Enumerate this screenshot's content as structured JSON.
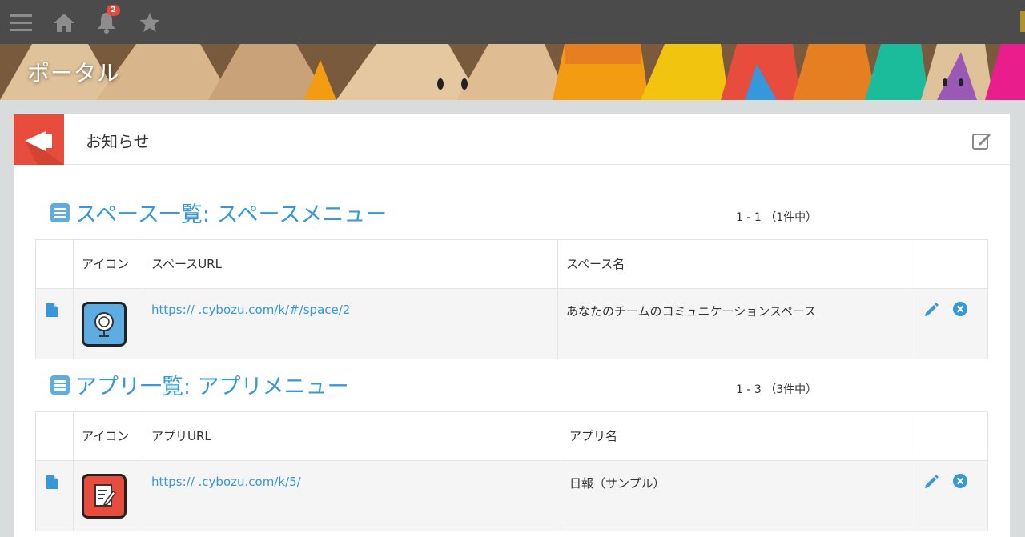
{
  "topbar": {
    "icons": [
      "menu-icon",
      "home-icon",
      "bell-icon",
      "star-icon"
    ],
    "notification_count": "2"
  },
  "banner": {
    "title": "ポータル"
  },
  "notice": {
    "title": "お知らせ"
  },
  "space_section": {
    "title": "スペース一覧: スペースメニュー",
    "count": "1 - 1 （1件中）",
    "columns": [
      "",
      "アイコン",
      "スペースURL",
      "スペース名",
      ""
    ],
    "rows": [
      {
        "url": "https://      .cybozu.com/k/#/space/2",
        "name": "あなたのチームのコミュニケーションスペース",
        "icon": "globe-icon"
      }
    ]
  },
  "app_section": {
    "title": "アプリ一覧: アプリメニュー",
    "count": "1 - 3 （3件中）",
    "columns": [
      "",
      "アイコン",
      "アプリURL",
      "アプリ名",
      ""
    ],
    "rows": [
      {
        "url": "https://      .cybozu.com/k/5/",
        "name": "日報（サンプル）",
        "icon": "report-icon"
      }
    ]
  },
  "colors": {
    "accent": "#3498db",
    "topbar": "#4b4b4b",
    "notice": "#e74c3c",
    "row_bg": "#f5f5f5"
  }
}
